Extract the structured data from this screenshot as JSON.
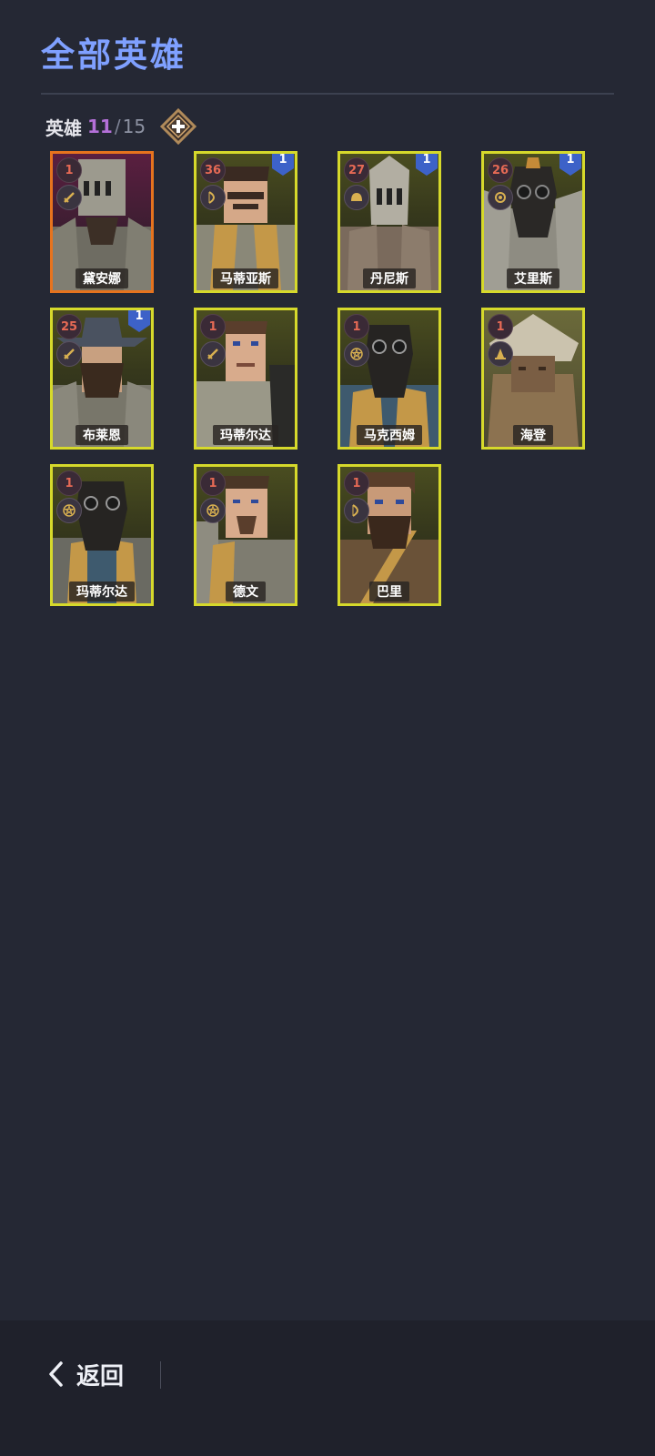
{
  "page": {
    "title": "全部英雄"
  },
  "count": {
    "label": "英雄",
    "current": "11",
    "slash": "/",
    "max": "15",
    "add_icon": "plus-diamond-icon"
  },
  "heroes": [
    {
      "name": "黛安娜",
      "level": "1",
      "badge": "",
      "role_icon": "sword-icon"
    },
    {
      "name": "马蒂亚斯",
      "level": "36",
      "badge": "1",
      "role_icon": "bow-icon"
    },
    {
      "name": "丹尼斯",
      "level": "27",
      "badge": "1",
      "role_icon": "helmet-icon"
    },
    {
      "name": "艾里斯",
      "level": "26",
      "badge": "1",
      "role_icon": "sun-icon"
    },
    {
      "name": "布莱恩",
      "level": "25",
      "badge": "1",
      "role_icon": "sword-icon"
    },
    {
      "name": "玛蒂尔达",
      "level": "1",
      "badge": "",
      "role_icon": "sword-icon"
    },
    {
      "name": "马克西姆",
      "level": "1",
      "badge": "",
      "role_icon": "pentagram-icon"
    },
    {
      "name": "海登",
      "level": "1",
      "badge": "",
      "role_icon": "wizard-hat-icon"
    },
    {
      "name": "玛蒂尔达",
      "level": "1",
      "badge": "",
      "role_icon": "pentagram-icon"
    },
    {
      "name": "德文",
      "level": "1",
      "badge": "",
      "role_icon": "pentagram-icon"
    },
    {
      "name": "巴里",
      "level": "1",
      "badge": "",
      "role_icon": "bow-icon"
    }
  ],
  "footer": {
    "back_label": "返回",
    "back_icon": "chevron-left-icon"
  },
  "colors": {
    "accent_title": "#7fa0ff",
    "count_current": "#b470d8",
    "card_border": "#d6d92b",
    "card_border_selected": "#e6731e",
    "level_text": "#e66a55"
  }
}
